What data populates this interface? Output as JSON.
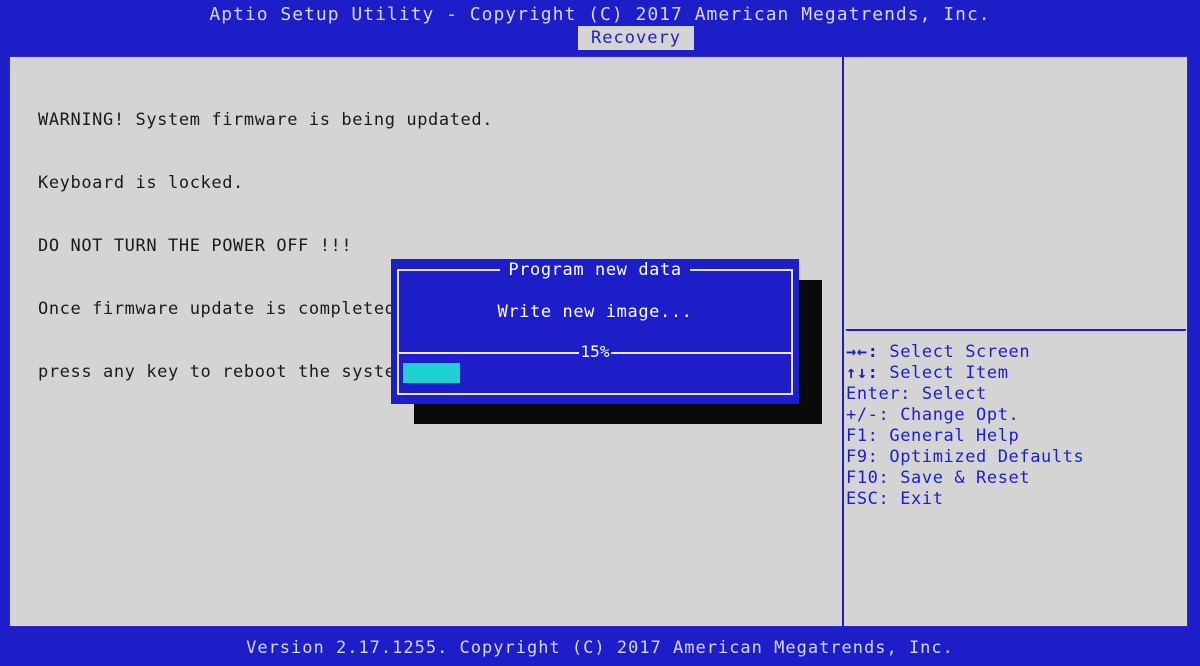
{
  "header": {
    "title": "Aptio Setup Utility - Copyright (C) 2017 American Megatrends, Inc.",
    "active_tab": "Recovery"
  },
  "warning_lines": [
    "WARNING! System firmware is being updated.",
    "Keyboard is locked.",
    "DO NOT TURN THE POWER OFF !!!",
    "Once firmware update is completed",
    "press any key to reboot the system"
  ],
  "dialog": {
    "title": "Program new data",
    "message": "Write new image...",
    "progress_label": "15%",
    "progress_fraction": 0.15
  },
  "help": [
    {
      "key": "→←:",
      "action": "Select Screen"
    },
    {
      "key": "↑↓:",
      "action": "Select Item"
    },
    {
      "key": "Enter:",
      "action": "Select"
    },
    {
      "key": "+/-:",
      "action": "Change Opt."
    },
    {
      "key": "F1:",
      "action": "General Help"
    },
    {
      "key": "F9:",
      "action": "Optimized Defaults"
    },
    {
      "key": "F10:",
      "action": "Save & Reset"
    },
    {
      "key": "ESC:",
      "action": "Exit"
    }
  ],
  "footer": {
    "version": "Version 2.17.1255. Copyright (C) 2017 American Megatrends, Inc."
  },
  "colors": {
    "bios_blue": "#1e1ec8",
    "panel_gray": "#d4d4d4",
    "progress_cyan": "#1ed2d2",
    "shadow": "#0a0a0a"
  }
}
